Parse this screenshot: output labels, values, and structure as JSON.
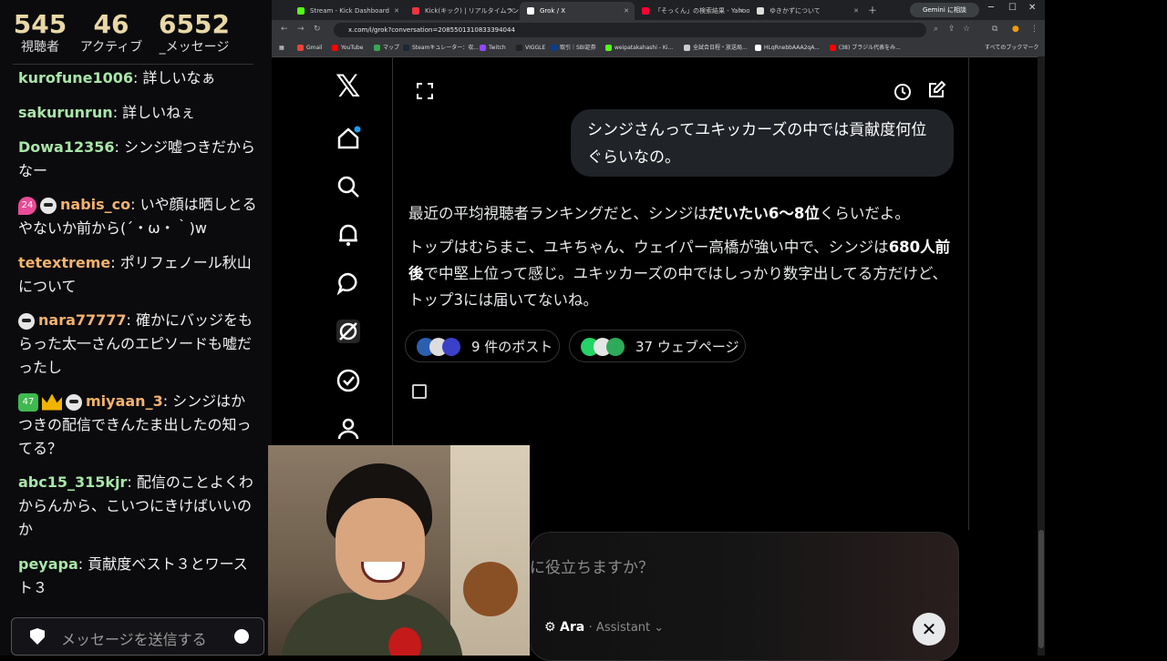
{
  "stream_stats": [
    {
      "value": "545",
      "label": "視聴者"
    },
    {
      "value": "46",
      "label": "アクティブ"
    },
    {
      "value": "6552",
      "label": "_メッセージ"
    }
  ],
  "chat": [
    {
      "user": "kurofune1006",
      "text": ": 詳しいなぁ"
    },
    {
      "user": "sakurunrun",
      "text": ": 詳しいねぇ"
    },
    {
      "user": "Dowa12356",
      "text": ": シンジ嘘つきだからなー"
    },
    {
      "user": "nabis_co",
      "badge_num": "24",
      "text": ": いや顔は晒しとるやないか前から(´・ω・｀)w"
    },
    {
      "user": "tetextreme",
      "text": ": ポリフェノール秋山について"
    },
    {
      "user": "nara77777",
      "text": ": 確かにバッジをもらった太一さんのエピソードも嘘だったし"
    },
    {
      "user": "miyaan_3",
      "badge_num": "47",
      "text": ": シンジはかつきの配信できんたま出したの知ってる？"
    },
    {
      "user": "abc15_315kjr",
      "text": ": 配信のことよくわからんから、こいつにきけばいいのか"
    },
    {
      "user": "peyapa",
      "text": ": 貢献度ベスト３とワースト３"
    }
  ],
  "chat_input_placeholder": "メッセージを送信する",
  "browser": {
    "tabs": [
      {
        "title": "Stream - Kick Dashboard",
        "color": "#53fc18"
      },
      {
        "title": "Kick(キック) | リアルタイムランキング",
        "color": "#e34"
      },
      {
        "title": "Grok / X",
        "color": "#fff",
        "active": true
      },
      {
        "title": "「そっくん」の検索結果 - Yahoo!検",
        "color": "#f03"
      },
      {
        "title": "ゆきかずについて",
        "color": "#ddd"
      }
    ],
    "gemini_label": "Gemini に相談",
    "url": "x.com/i/grok?conversation=2085501310833394044",
    "bookmarks": [
      "Gmail",
      "YouTube",
      "マップ",
      "Steamキュレーター：収...",
      "Twitch",
      "VIGGLE",
      "取引｜SBI証券",
      "weipatakahashi - Ki...",
      "全試合日程・放送局...",
      "HLqRnebbAAA2qA...",
      "(38) ブラジル代表をみ..."
    ],
    "bookmarks_right": "すべてのブックマーク"
  },
  "grok": {
    "user_message": "シンジさんってユキッカーズの中では貢献度何位ぐらいなの。",
    "reply_p1_pre": "最近の平均視聴者ランキングだと、シンジは",
    "reply_p1_bold": "だいたい6〜8位",
    "reply_p1_post": "くらいだよ。",
    "reply_p2_pre": "トップはむらまこ、ユキちゃん、ウェイパー高橋が強い中で、シンジは",
    "reply_p2_bold": "680人前後",
    "reply_p2_post": "で中堅上位って感じ。ユキッカーズの中ではしっかり数字出してる方だけど、トップ3には届いてないね。",
    "posts_pill": "9 件のポスト",
    "web_pill": "37 ウェブページ",
    "input_placeholder": "に役立ちますか？",
    "model_name": "Ara",
    "model_sub": "Assistant"
  }
}
